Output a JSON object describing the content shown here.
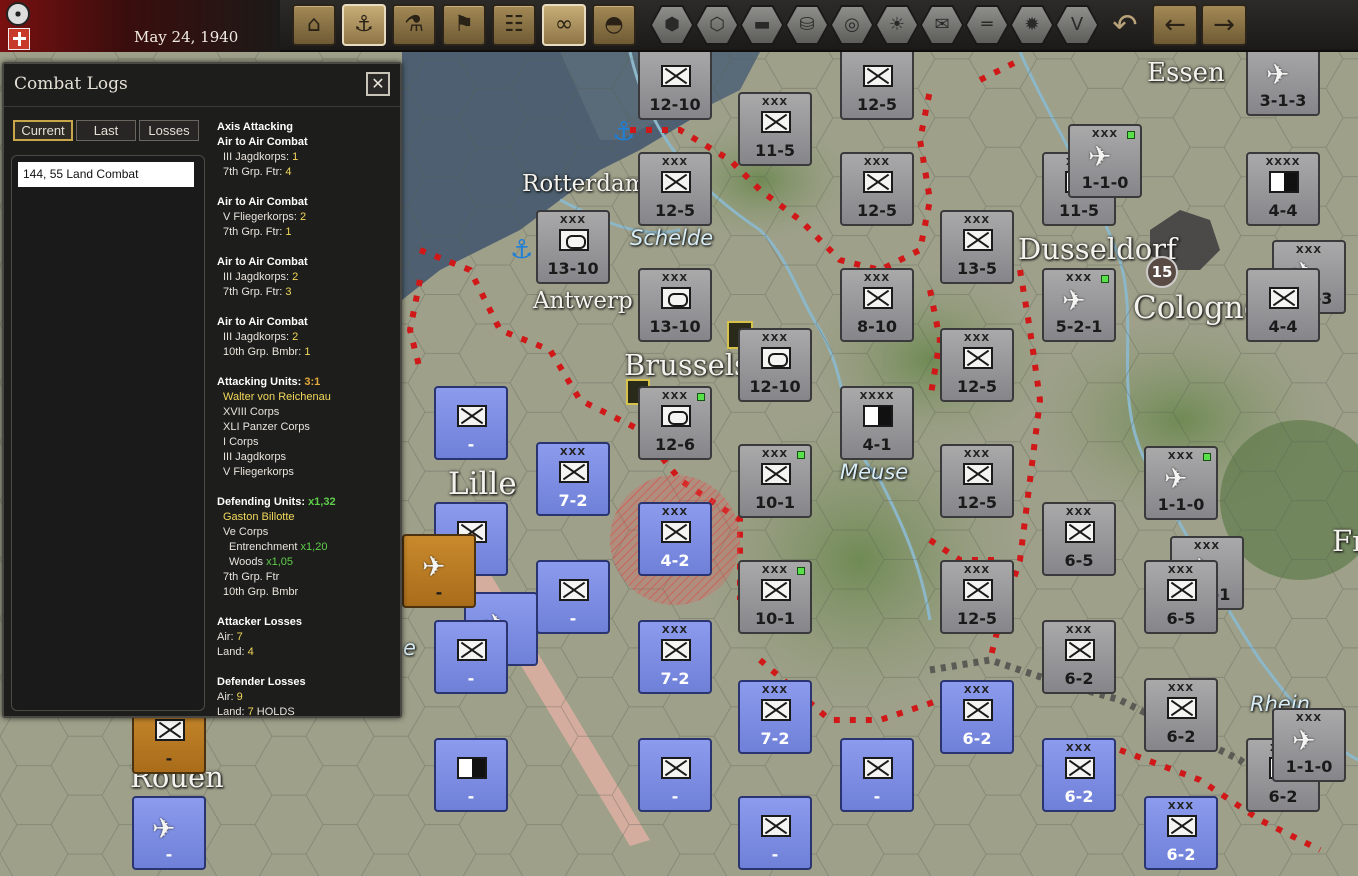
{
  "topbar": {
    "date": "May 24, 1940",
    "buttons": [
      {
        "name": "production-button",
        "icon": "factory-icon",
        "glyph": "⌂"
      },
      {
        "name": "naval-button",
        "icon": "ship-icon",
        "glyph": "⚓"
      },
      {
        "name": "research-button",
        "icon": "microscope-icon",
        "glyph": "⚗"
      },
      {
        "name": "diplomacy-button",
        "icon": "flag-icon",
        "glyph": "⚑"
      },
      {
        "name": "reports-button",
        "icon": "clipboard-icon",
        "glyph": "☷"
      },
      {
        "name": "intel-button",
        "icon": "binoculars-icon",
        "glyph": "∞"
      },
      {
        "name": "units-button",
        "icon": "helmet-icon",
        "glyph": "◓"
      }
    ],
    "hex_buttons": [
      {
        "name": "hex-grid-button",
        "glyph": "⬢"
      },
      {
        "name": "hex-cluster-button",
        "glyph": "⬡"
      },
      {
        "name": "tank-filter-button",
        "glyph": "▬"
      },
      {
        "name": "resources-button",
        "glyph": "⛁"
      },
      {
        "name": "target-button",
        "glyph": "◎"
      },
      {
        "name": "weather-button",
        "glyph": "☀"
      },
      {
        "name": "mail-button",
        "glyph": "✉"
      },
      {
        "name": "frontline-button",
        "glyph": "═"
      },
      {
        "name": "explosion-button",
        "glyph": "✹"
      },
      {
        "name": "victory-button",
        "glyph": "V"
      }
    ],
    "undo_glyph": "↶",
    "prev_glyph": "←",
    "next_glyph": "→"
  },
  "combat_logs": {
    "title": "Combat Logs",
    "close_glyph": "✕",
    "tabs": [
      "Current",
      "Last",
      "Losses"
    ],
    "active_tab": "Current",
    "selected_entry": "144, 55 Land Combat",
    "details": {
      "section": "Axis Attacking",
      "air_combats": [
        {
          "title": "Air to Air Combat",
          "a_name": "III Jagdkorps:",
          "a_val": "1",
          "b_name": "7th Grp. Ftr:",
          "b_val": "4"
        },
        {
          "title": "Air to Air Combat",
          "a_name": "V Fliegerkorps:",
          "a_val": "2",
          "b_name": "7th Grp. Ftr:",
          "b_val": "1"
        },
        {
          "title": "Air to Air Combat",
          "a_name": "III Jagdkorps:",
          "a_val": "2",
          "b_name": "7th Grp. Ftr:",
          "b_val": "3"
        },
        {
          "title": "Air to Air Combat",
          "a_name": "III Jagdkorps:",
          "a_val": "2",
          "b_name": "10th Grp. Bmbr:",
          "b_val": "1"
        }
      ],
      "attacking_label": "Attacking Units:",
      "attacking_ratio": "3:1",
      "attacking_commander": "Walter von Reichenau",
      "attacking_units": [
        "XVIII Corps",
        "XLI Panzer Corps",
        "I Corps",
        "III Jagdkorps",
        "V Fliegerkorps"
      ],
      "defending_label": "Defending Units:",
      "defending_mod": "x1,32",
      "defending_commander": "Gaston Billotte",
      "defending_unit": "Ve Corps",
      "entrenchment_label": "Entrenchment",
      "entrenchment_mod": "x1,20",
      "woods_label": "Woods",
      "woods_mod": "x1,05",
      "defending_support": [
        "7th Grp. Ftr",
        "10th Grp. Bmbr"
      ],
      "attacker_losses_label": "Attacker Losses",
      "attacker_air_label": "Air:",
      "attacker_air": "7",
      "attacker_land_label": "Land:",
      "attacker_land": "4",
      "defender_losses_label": "Defender Losses",
      "defender_air_label": "Air:",
      "defender_air": "9",
      "defender_land_label": "Land:",
      "defender_land": "7",
      "defender_result": "HOLDS"
    }
  },
  "map": {
    "cities": [
      "Essen",
      "Rotterdam",
      "Antwerp",
      "Brussels",
      "Dusseldorf",
      "Cologne",
      "Lille",
      "Rouen",
      "Fr"
    ],
    "waters": [
      "Schelde",
      "Meuse",
      "Rhein",
      "e"
    ],
    "city_badge": "15",
    "units": [
      {
        "side": "ger",
        "size": "",
        "sym": "inf",
        "str": "12-10",
        "sup": false
      },
      {
        "side": "ger",
        "size": "",
        "sym": "inf",
        "str": "12-5",
        "sup": false
      },
      {
        "side": "ger",
        "size": "XXX",
        "sym": "inf",
        "str": "11-5",
        "sup": false
      },
      {
        "side": "ger",
        "size": "XXX",
        "sym": "inf",
        "str": "12-5",
        "sup": false
      },
      {
        "side": "ger",
        "size": "XXX",
        "sym": "inf",
        "str": "12-5",
        "sup": false
      },
      {
        "side": "ger",
        "size": "XXX",
        "sym": "arm",
        "str": "13-10",
        "sup": false
      },
      {
        "side": "ger",
        "size": "XXX",
        "sym": "inf",
        "str": "13-5",
        "sup": false
      },
      {
        "side": "ger",
        "size": "XXX",
        "sym": "arm",
        "str": "13-10",
        "sup": false
      },
      {
        "side": "ger",
        "size": "XXX",
        "sym": "inf",
        "str": "8-10",
        "sup": false
      },
      {
        "side": "ger",
        "size": "XXX",
        "sym": "arm",
        "str": "12-10",
        "sup": false
      },
      {
        "side": "ger",
        "size": "XXX",
        "sym": "inf",
        "str": "12-5",
        "sup": false
      },
      {
        "side": "ger",
        "size": "XXX",
        "sym": "arm",
        "str": "12-6",
        "sup": true
      },
      {
        "side": "ger",
        "size": "XXXX",
        "sym": "hq",
        "str": "4-1",
        "sup": false
      },
      {
        "side": "ger",
        "size": "XXX",
        "sym": "inf",
        "str": "10-1",
        "sup": true
      },
      {
        "side": "ger",
        "size": "XXX",
        "sym": "inf",
        "str": "12-5",
        "sup": false
      },
      {
        "side": "ger",
        "size": "XXX",
        "sym": "inf",
        "str": "10-1",
        "sup": true
      },
      {
        "side": "ger",
        "size": "XXX",
        "sym": "inf",
        "str": "12-5",
        "sup": false
      },
      {
        "side": "ger",
        "size": "XXX",
        "sym": "inf",
        "str": "6-5",
        "sup": false
      },
      {
        "side": "ger",
        "size": "XXX",
        "sym": "inf",
        "str": "6-2",
        "sup": false
      },
      {
        "side": "ger",
        "size": "XXX",
        "sym": "inf",
        "str": "6-2",
        "sup": false
      },
      {
        "side": "ger",
        "size": "XXX",
        "sym": "inf",
        "str": "6-2",
        "sup": false
      },
      {
        "side": "ger",
        "size": "XXX",
        "sym": "inf",
        "str": "11-5",
        "sup": false
      },
      {
        "side": "ger",
        "size": "XXX",
        "sym": "air",
        "str": "1-1-0",
        "sup": true
      },
      {
        "side": "ger",
        "size": "XXX",
        "sym": "air",
        "str": "5-2-1",
        "sup": true
      },
      {
        "side": "ger",
        "size": "XXX",
        "sym": "air",
        "str": "1-1-0",
        "sup": true
      },
      {
        "side": "ger",
        "size": "XXX",
        "sym": "air",
        "str": "5-2-1",
        "sup": false
      },
      {
        "side": "ger",
        "size": "XXXX",
        "sym": "hq",
        "str": "4-4",
        "sup": false
      },
      {
        "side": "ger",
        "size": "",
        "sym": "air",
        "str": "3-1-3",
        "sup": false
      },
      {
        "side": "ger",
        "size": "XXX",
        "sym": "air",
        "str": "3-1-3",
        "sup": false
      },
      {
        "side": "ger",
        "size": "",
        "sym": "inf",
        "str": "4-4",
        "sup": false
      },
      {
        "side": "ger",
        "size": "XXX",
        "sym": "air",
        "str": "1-1-0",
        "sup": false
      },
      {
        "side": "ger",
        "size": "XXX",
        "sym": "inf",
        "str": "6-5",
        "sup": false
      },
      {
        "side": "fr",
        "size": "XXX",
        "sym": "inf",
        "str": "7-2",
        "sup": false
      },
      {
        "side": "fr",
        "size": "XXX",
        "sym": "inf",
        "str": "4-2",
        "sup": false
      },
      {
        "side": "fr",
        "size": "XXX",
        "sym": "inf",
        "str": "7-2",
        "sup": false
      },
      {
        "side": "fr",
        "size": "XXX",
        "sym": "inf",
        "str": "7-2",
        "sup": false
      },
      {
        "side": "fr",
        "size": "XXX",
        "sym": "inf",
        "str": "6-2",
        "sup": false
      },
      {
        "side": "fr",
        "size": "XXX",
        "sym": "inf",
        "str": "6-2",
        "sup": false
      },
      {
        "side": "fr",
        "size": "XXX",
        "sym": "inf",
        "str": "6-2",
        "sup": false
      },
      {
        "side": "fr",
        "size": "",
        "sym": "inf",
        "str": "-",
        "sup": false
      },
      {
        "side": "fr",
        "size": "",
        "sym": "inf",
        "str": "-",
        "sup": false
      },
      {
        "side": "fr",
        "size": "",
        "sym": "inf",
        "str": "-",
        "sup": false
      },
      {
        "side": "fr",
        "size": "",
        "sym": "air",
        "str": "-",
        "sup": false
      },
      {
        "side": "fr",
        "size": "",
        "sym": "inf",
        "str": "-",
        "sup": false
      },
      {
        "side": "fr",
        "size": "",
        "sym": "hq",
        "str": "-",
        "sup": false
      },
      {
        "side": "fr",
        "size": "",
        "sym": "inf",
        "str": "-",
        "sup": false
      },
      {
        "side": "fr",
        "size": "",
        "sym": "inf",
        "str": "-",
        "sup": false
      },
      {
        "side": "fr",
        "size": "",
        "sym": "inf",
        "str": "-",
        "sup": false
      },
      {
        "side": "fr",
        "size": "",
        "sym": "air",
        "str": "-",
        "sup": false
      },
      {
        "side": "be",
        "size": "",
        "sym": "air",
        "str": "-",
        "sup": false
      },
      {
        "side": "be",
        "size": "",
        "sym": "inf",
        "str": "-",
        "sup": false
      }
    ]
  },
  "colors": {
    "german_counter": "#9a9a9c",
    "french_counter": "#7b8be0",
    "belgian_counter": "#b97a22",
    "frontline": "#d01818",
    "highlight_gold": "#f1d85a",
    "modifier_green": "#5fce4a",
    "attack_ratio_orange": "#e3a93a"
  }
}
